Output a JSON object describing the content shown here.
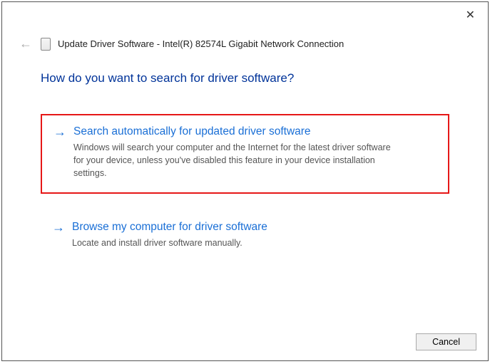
{
  "window": {
    "title": "Update Driver Software - Intel(R) 82574L Gigabit Network Connection"
  },
  "heading": "How do you want to search for driver software?",
  "options": [
    {
      "title": "Search automatically for updated driver software",
      "description": "Windows will search your computer and the Internet for the latest driver software for your device, unless you've disabled this feature in your device installation settings."
    },
    {
      "title": "Browse my computer for driver software",
      "description": "Locate and install driver software manually."
    }
  ],
  "buttons": {
    "cancel": "Cancel"
  }
}
